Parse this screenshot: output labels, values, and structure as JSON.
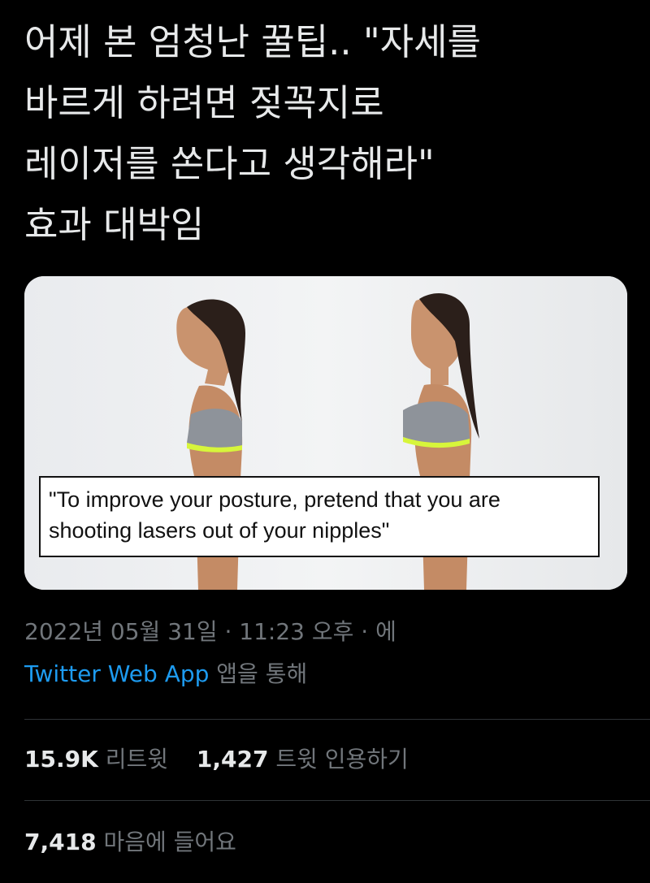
{
  "tweet": {
    "lines": [
      "어제 본 엄청난 꿀팁.. \"자세를",
      "바르게 하려면 젖꼭지로",
      "레이저를 쏜다고 생각해라\"",
      "효과 대박임"
    ]
  },
  "media": {
    "caption_lines": [
      "\"To improve your posture, pretend that you are",
      "shooting lasers out of your nipples\""
    ]
  },
  "meta": {
    "datetime": "2022년 05월 31일 · 11:23 오후 · 에",
    "app_name": "Twitter Web App",
    "app_suffix": " 앱을 통해"
  },
  "stats": {
    "retweets_count": "15.9K",
    "retweets_label": "리트윗",
    "quotes_count": "1,427",
    "quotes_label": "트윗 인용하기",
    "likes_count": "7,418",
    "likes_label": "마음에 들어요"
  }
}
